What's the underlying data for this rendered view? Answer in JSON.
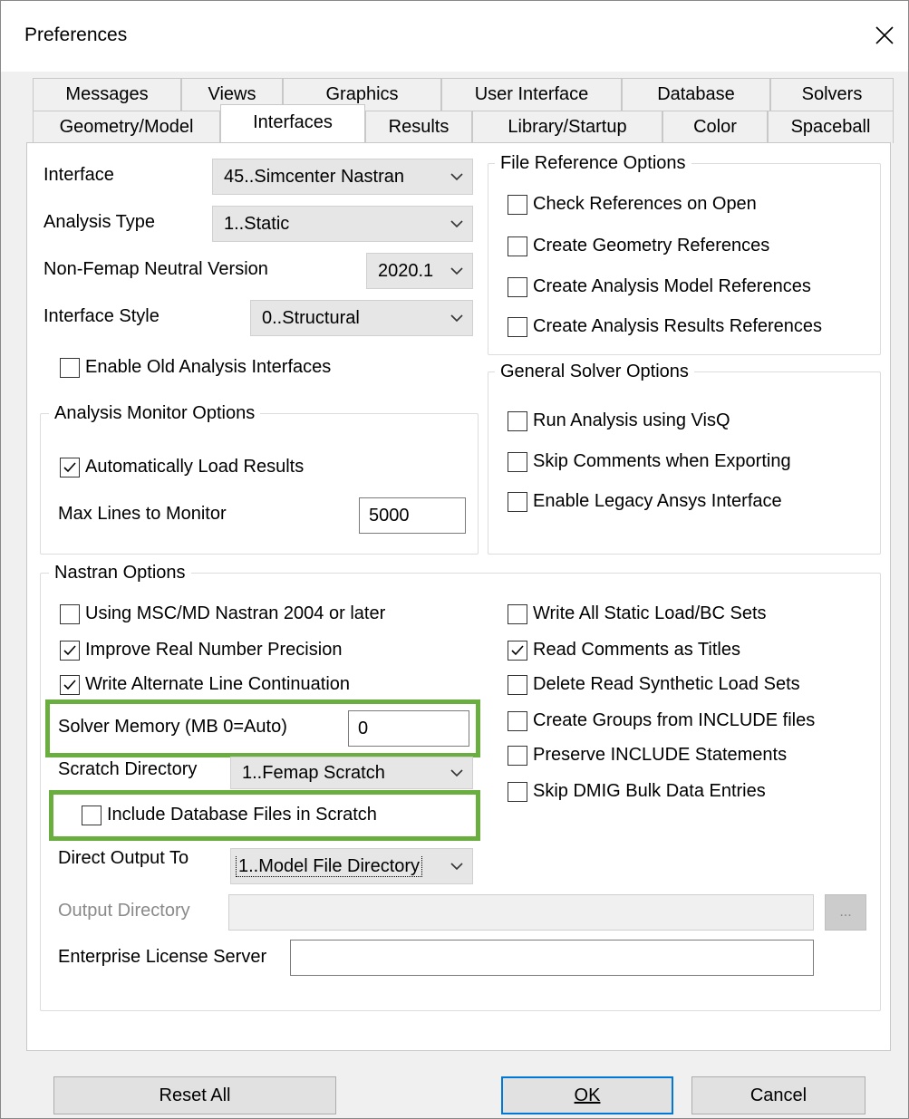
{
  "window": {
    "title": "Preferences"
  },
  "tabs_row1": [
    "Messages",
    "Views",
    "Graphics",
    "User Interface",
    "Database",
    "Solvers"
  ],
  "tabs_row2": [
    "Geometry/Model",
    "Interfaces",
    "Results",
    "Library/Startup",
    "Color",
    "Spaceball"
  ],
  "active_tab": "Interfaces",
  "interface": {
    "interface_label": "Interface",
    "interface_value": "45..Simcenter Nastran",
    "analysis_type_label": "Analysis Type",
    "analysis_type_value": "1..Static",
    "neutral_label": "Non-Femap Neutral Version",
    "neutral_value": "2020.1",
    "style_label": "Interface Style",
    "style_value": "0..Structural",
    "enable_old_label": "Enable Old Analysis Interfaces",
    "enable_old_checked": false
  },
  "monitor": {
    "title": "Analysis Monitor Options",
    "auto_load_label": "Automatically Load Results",
    "auto_load_checked": true,
    "max_lines_label": "Max Lines to Monitor",
    "max_lines_value": "5000"
  },
  "file_ref": {
    "title": "File Reference Options",
    "items": [
      {
        "label": "Check References on Open",
        "checked": false
      },
      {
        "label": "Create Geometry References",
        "checked": false
      },
      {
        "label": "Create Analysis Model References",
        "checked": false
      },
      {
        "label": "Create Analysis Results References",
        "checked": false
      }
    ]
  },
  "solver": {
    "title": "General Solver Options",
    "items": [
      {
        "label": "Run Analysis using VisQ",
        "checked": false
      },
      {
        "label": "Skip Comments when Exporting",
        "checked": false
      },
      {
        "label": "Enable Legacy Ansys Interface",
        "checked": false
      }
    ]
  },
  "nastran": {
    "title": "Nastran Options",
    "left_items": [
      {
        "label": "Using MSC/MD Nastran 2004 or later",
        "checked": false
      },
      {
        "label": "Improve Real Number Precision",
        "checked": true
      },
      {
        "label": "Write Alternate Line Continuation",
        "checked": true
      }
    ],
    "right_items": [
      {
        "label": "Write All Static Load/BC Sets",
        "checked": false
      },
      {
        "label": "Read Comments as Titles",
        "checked": true
      },
      {
        "label": "Delete Read Synthetic Load Sets",
        "checked": false
      },
      {
        "label": "Create Groups from INCLUDE files",
        "checked": false
      },
      {
        "label": "Preserve INCLUDE Statements",
        "checked": false
      },
      {
        "label": "Skip DMIG Bulk Data Entries",
        "checked": false
      }
    ],
    "solver_memory_label": "Solver Memory (MB 0=Auto)",
    "solver_memory_value": "0",
    "scratch_dir_label": "Scratch Directory",
    "scratch_dir_value": "1..Femap Scratch",
    "include_db_label": "Include Database Files in Scratch",
    "include_db_checked": false,
    "direct_output_label": "Direct Output To",
    "direct_output_value": "1..Model File Directory",
    "output_dir_label": "Output Directory",
    "output_dir_value": "",
    "browse_label": "...",
    "license_label": "Enterprise License Server",
    "license_value": ""
  },
  "buttons": {
    "reset": "Reset All",
    "ok": "OK",
    "cancel": "Cancel"
  },
  "colors": {
    "highlight": "#6aae3f",
    "default_button_border": "#0078d7"
  }
}
